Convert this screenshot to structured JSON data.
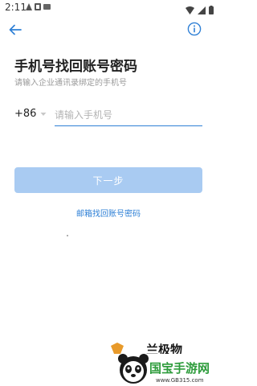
{
  "status_bar": {
    "time": "2:11",
    "icons": [
      "notification-icon",
      "square-icon",
      "notification-icon",
      "wifi-icon",
      "signal-icon",
      "battery-icon"
    ]
  },
  "toolbar": {
    "back_icon": "back-arrow-icon",
    "info_icon": "info-icon"
  },
  "page": {
    "title": "手机号找回账号密码",
    "subtitle": "请输入企业通讯录绑定的手机号"
  },
  "form": {
    "country_code": "+86",
    "phone_placeholder": "请输入手机号",
    "phone_value": ""
  },
  "actions": {
    "next_label": "下一步",
    "email_link": "邮箱找回账号密码"
  },
  "watermark": {
    "brand_text": "国宝手游网",
    "url": "www.GB315.com",
    "partial_text": "兰极物"
  },
  "colors": {
    "accent": "#2f80d6",
    "button_disabled": "#a9cbf2",
    "title": "#222222",
    "subtitle": "#9a9a9a"
  }
}
